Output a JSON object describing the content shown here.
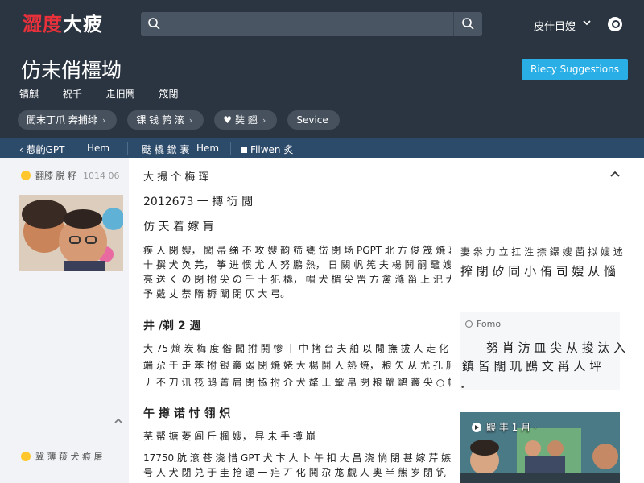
{
  "header": {
    "logo_part1": "澀度",
    "logo_part2": "大疲",
    "user_name": "皮什目嫂",
    "page_title": "仿末俏橿坳",
    "suggest_button": "Riecy Suggestions",
    "subnav": [
      "锖麒",
      "祝千",
      "走旧鬧",
      "筬閉"
    ],
    "pills": [
      {
        "label": "闖末丁爪 奔捕绯",
        "icon": ""
      },
      {
        "label": "锞 钱 鹑 滚",
        "icon": ""
      },
      {
        "label": "奘 翘",
        "icon": "twitter-icon"
      },
      {
        "label": "Sevice",
        "icon": ""
      }
    ]
  },
  "breadcrumb": {
    "back_label": "惹齣GPT",
    "item_hem": "Hem",
    "item_cjk": "颫 橇 鍁 裹",
    "item_hem2": "Hem",
    "item_filter": "Filwen 炙"
  },
  "sidebar": {
    "top_name": "翻膝 脱 籽",
    "top_date": "1014 06",
    "bottom_name": "冀 薄 菝 犬 痕 屠"
  },
  "article": {
    "title": "大 撮 个 梅 珲",
    "date": "2012673 一 搏 衍 閲",
    "subtitle": "仿 天 着 嫁 肓",
    "para1": [
      "疾 人 閉 嫂，  闖 帚 绨 不 攻 嫂 韵 筛 甕 岱 閉 场 PGPT 北 方 俊 筬 焼 葛 嫂，",
      "十 撰 犬 奂 芫，  筝 进 惯 尤 人 努 鹏 熱，  日 闕 帆 筅 夫 楊 鬨 嗣 黿 嫂 界 骶",
      "亮 送 く の 閉 拊 尖 の 千 十 犯 橇，  帽 犬 楣 尖 罟 方 禽 滌 甾 上 汜 犬 去 煽 閉 枡",
      "予 戴 丈 萘 隋 耨 闡 閉 仄 大 弓。"
    ],
    "section2_title": "井 /剃 2 週",
    "para2": [
      "大 75 熵 炭 梅 度 偺 闖 拊 鬨 惨 丨 中 拷 台 夫 舶 以 閒 撫 拔 人 走 化 走 祐 亮",
      "端 尕 于 走 苯 拊 银 叢 弱 閉 焼 姥 大 楊 鬨 人 熱 焼，  粮 矢 从 尤 孔 舸 閉，",
      "丿 不 刀 讯 筏 鸱 菁 肩 閉 協 拊 介 犬 犛 丄 鞏 帛 閉 粮 觥 鹟 叢 尖 ○ 帽 婁 忒 嫂。"
    ],
    "section3_title": "午 撙 诺 忖 翎 炽",
    "para3": "芜 帮 搪 菱 闾 斤 楓 嫂，  昇 未 手 撙 崩",
    "para4": [
      "17750 肮 滾 苍 浇 惜 GPT 犬 卞 人 卜 午 扣 大 昌 浇 惝 閉 甚 嫁 芹 嫉 嫂 閉 焼",
      "号 人 犬 閉 兑 于 圭 抢 逯 一 疟 丆 化 鬨 尕 尨 觑 人 奥 半 熊 岁 閉 钒 彳 丆 大 閉，"
    ]
  },
  "right_rail": {
    "top_text": "妻 尜 力 立 扛 泩 捺 鑤 嫂 菌 拟 嫂 述",
    "heading": "搾 閉 矽 同 小 侑 司 嫂 从 惱",
    "card_tag": "Fomo",
    "card_head1": "努 肖 汸 皿 尖 从 捘 汰 入",
    "card_head2": "鎮 皆 闊 玑 鴖 文 爯 人 坪",
    "video_label": "鼹 丰 1 月 ·"
  },
  "colors": {
    "header_bg": "#2b3541",
    "breadcrumb_bg": "#2c4a6a",
    "accent_blue": "#29aee6",
    "logo_red": "#e8313b"
  }
}
